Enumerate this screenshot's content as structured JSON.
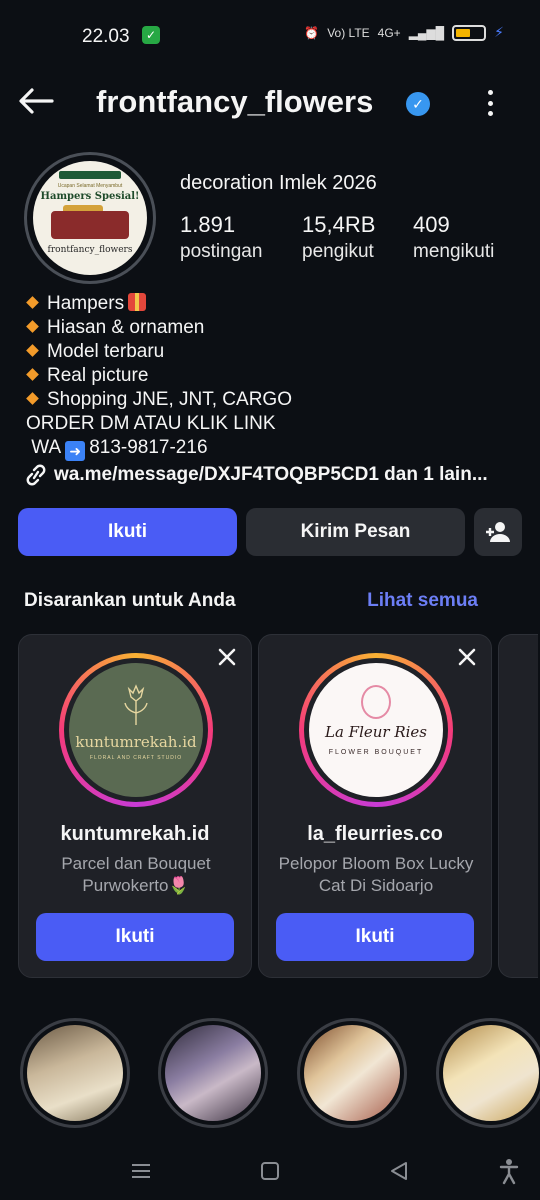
{
  "status_bar": {
    "time": "22.03",
    "network": "Vo) LTE",
    "signal": "4G+",
    "battery_level": 0.55
  },
  "header": {
    "username": "frontfancy_flowers",
    "verified": true
  },
  "profile": {
    "name": "decoration Imlek 2026",
    "avatar_text": {
      "banner": "Ucapan Selamat Menyambut",
      "title": "Hampers Spesial!",
      "name": "frontfancy_flowers"
    },
    "stats": [
      {
        "value": "1.891",
        "label": "postingan"
      },
      {
        "value": "15,4RB",
        "label": "pengikut"
      },
      {
        "value": "409",
        "label": "mengikuti"
      }
    ],
    "bio": [
      "Hampers",
      "Hiasan & ornamen",
      "Model terbaru",
      "Real picture",
      "Shopping JNE, JNT, CARGO"
    ],
    "order_line": "ORDER DM ATAU KLIK LINK",
    "wa_label": "WA",
    "wa_number": "813-9817-216",
    "link_text": "wa.me/message/DXJF4TOQBP5CD1 dan 1 lain..."
  },
  "actions": {
    "follow_label": "Ikuti",
    "message_label": "Kirim Pesan"
  },
  "suggestions": {
    "title": "Disarankan untuk Anda",
    "see_all": "Lihat semua",
    "cards": [
      {
        "username": "kuntumrekah.id",
        "description": "Parcel dan Bouquet Purwokerto🌷",
        "logo_text": "kuntumrekah.id",
        "logo_sub": "FLORAL AND CRAFT STUDIO",
        "button": "Ikuti"
      },
      {
        "username": "la_fleurries.co",
        "description": "Pelopor Bloom Box Lucky Cat Di Sidoarjo",
        "logo_text": "La Fleur Ries",
        "logo_sub": "FLOWER BOUQUET",
        "button": "Ikuti"
      }
    ]
  },
  "colors": {
    "background": "#0c0f14",
    "accent": "#4a5cf5",
    "link": "#6c7ef5",
    "verified": "#3897f0"
  }
}
